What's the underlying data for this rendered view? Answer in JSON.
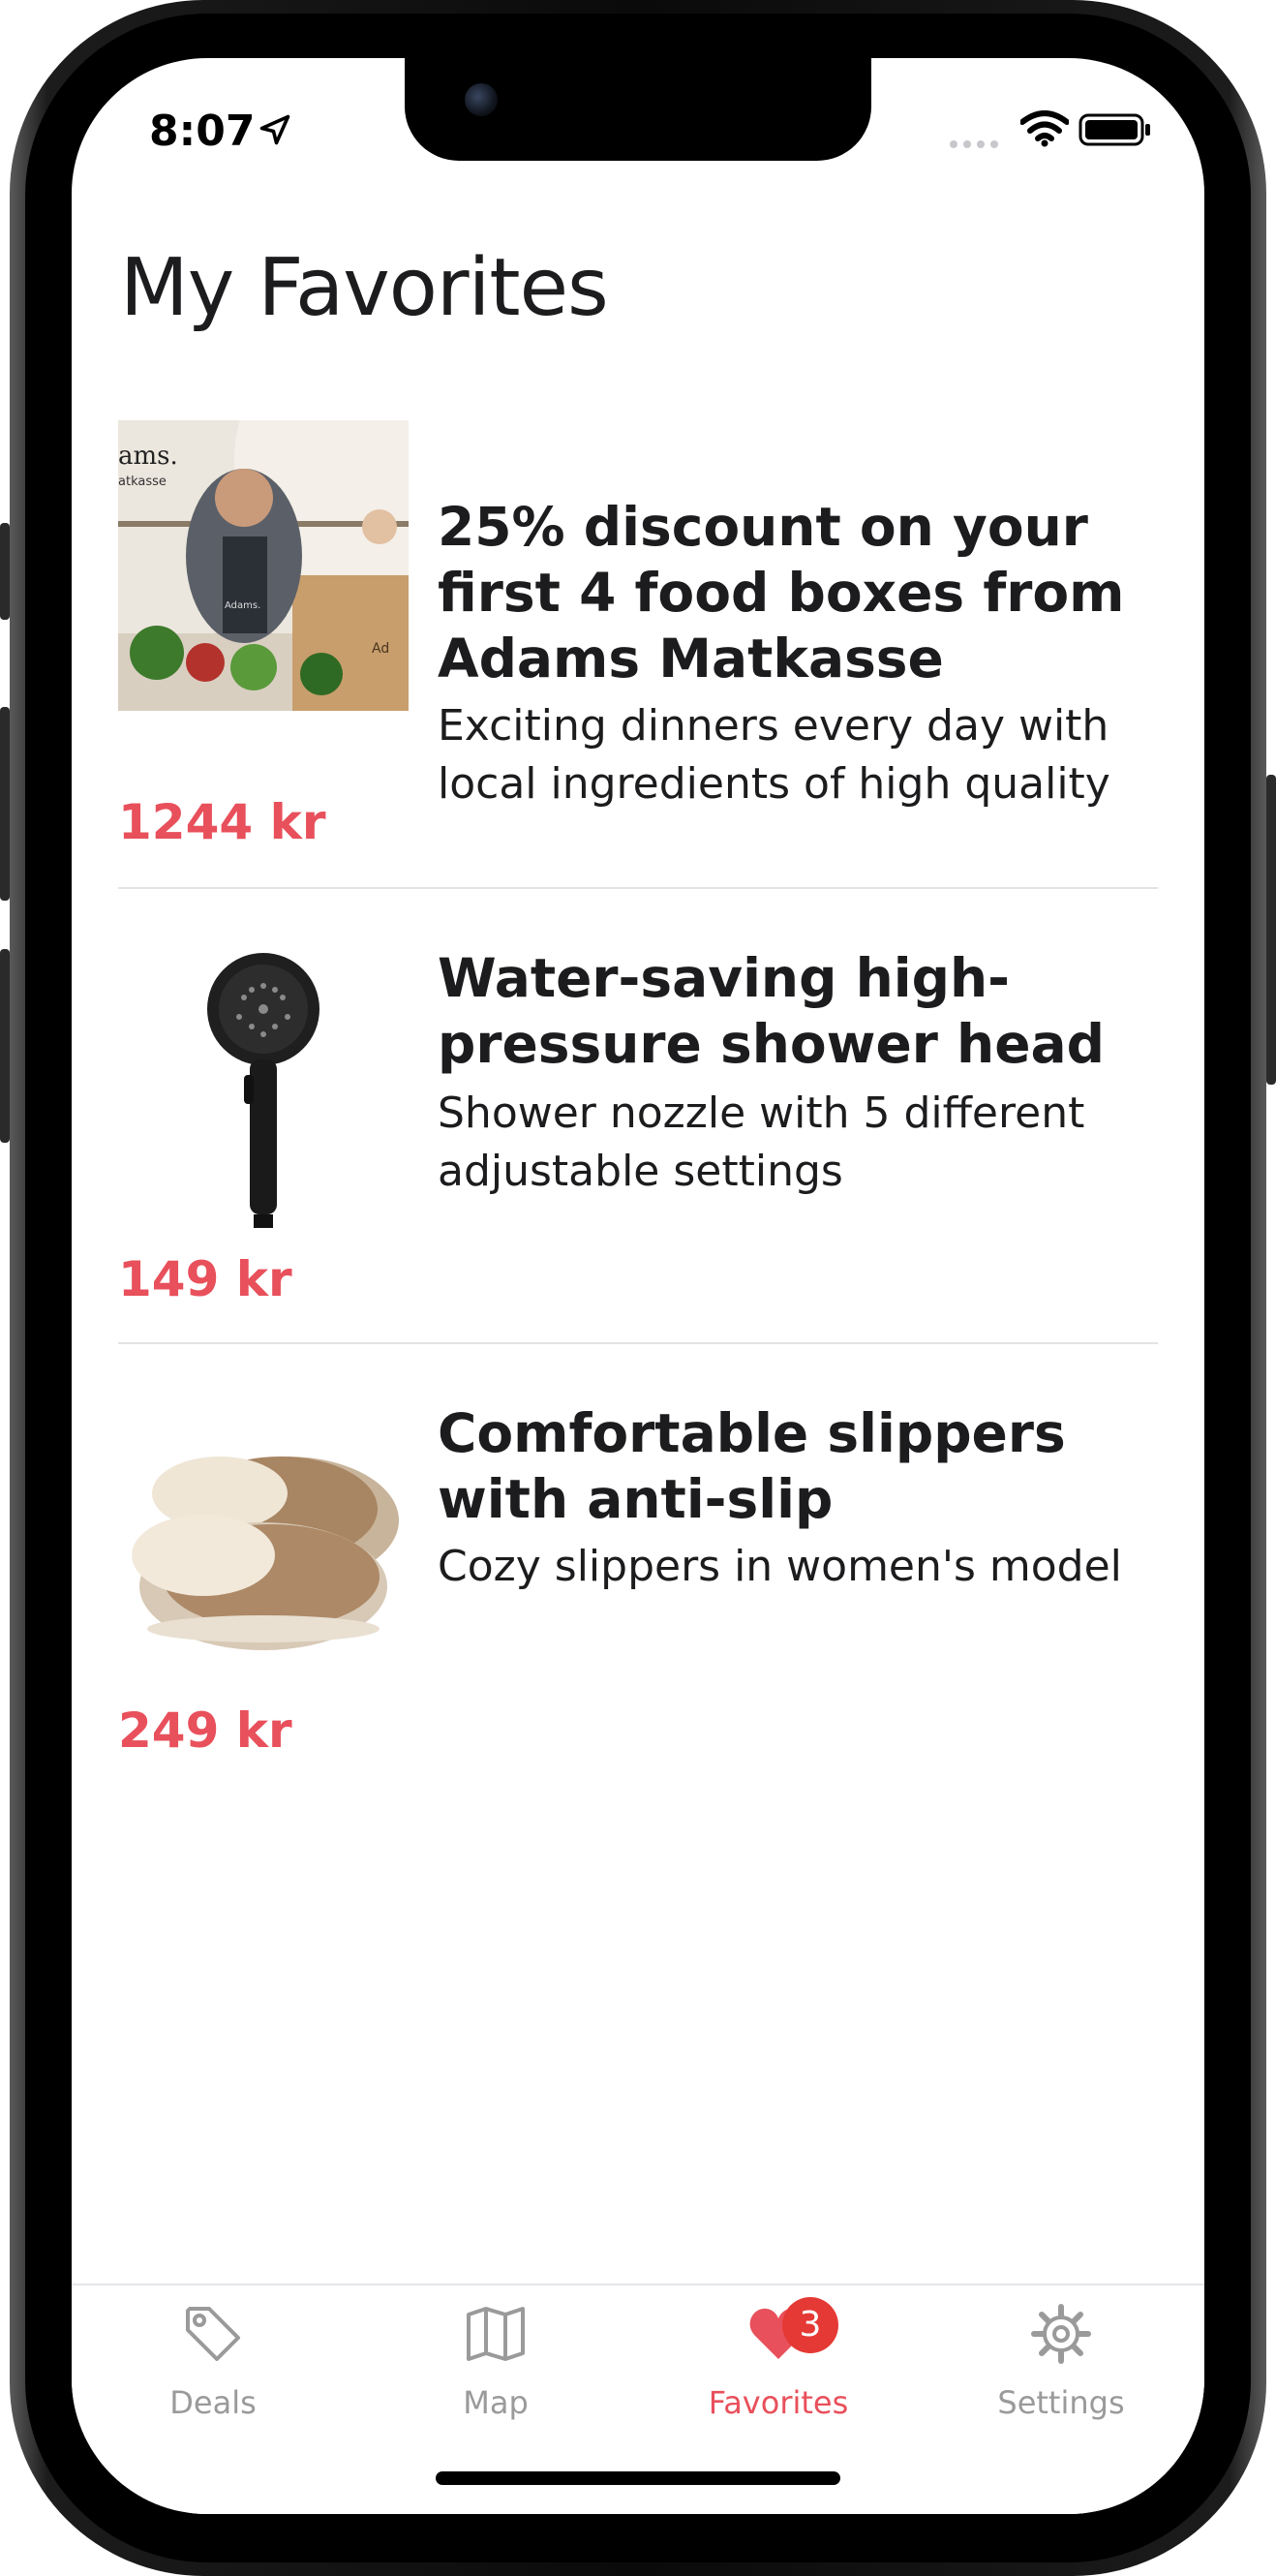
{
  "status_bar": {
    "time": "8:07",
    "icons": [
      "location-arrow-icon",
      "signal-dots-icon",
      "wifi-icon",
      "battery-icon"
    ]
  },
  "page": {
    "title": "My Favorites"
  },
  "favorites": [
    {
      "title": "25% discount on your first 4 food boxes from Adams Matkasse",
      "description": "Exciting dinners every day with local ingredients of high quality",
      "price": "1244 kr",
      "thumb_logo": "ams.",
      "thumb_logo_sub": "atkasse",
      "thumb_apron_text": "Adams.",
      "thumb_box_text": "Ad"
    },
    {
      "title": "Water-saving high-pressure shower head",
      "description": "Shower nozzle with 5 different adjustable settings",
      "price": "149 kr"
    },
    {
      "title": "Comfortable slippers with anti-slip",
      "description": "Cozy slippers in women's model",
      "price": "249 kr"
    }
  ],
  "tab_bar": {
    "tabs": [
      {
        "label": "Deals",
        "icon": "tag-icon",
        "active": false
      },
      {
        "label": "Map",
        "icon": "map-icon",
        "active": false
      },
      {
        "label": "Favorites",
        "icon": "heart-icon",
        "active": true,
        "badge": "3"
      },
      {
        "label": "Settings",
        "icon": "gear-icon",
        "active": false
      }
    ]
  },
  "colors": {
    "accent": "#e8505b",
    "badge": "#e53935",
    "inactive_tab": "#9a9a9a",
    "text": "#1c1c1e"
  }
}
